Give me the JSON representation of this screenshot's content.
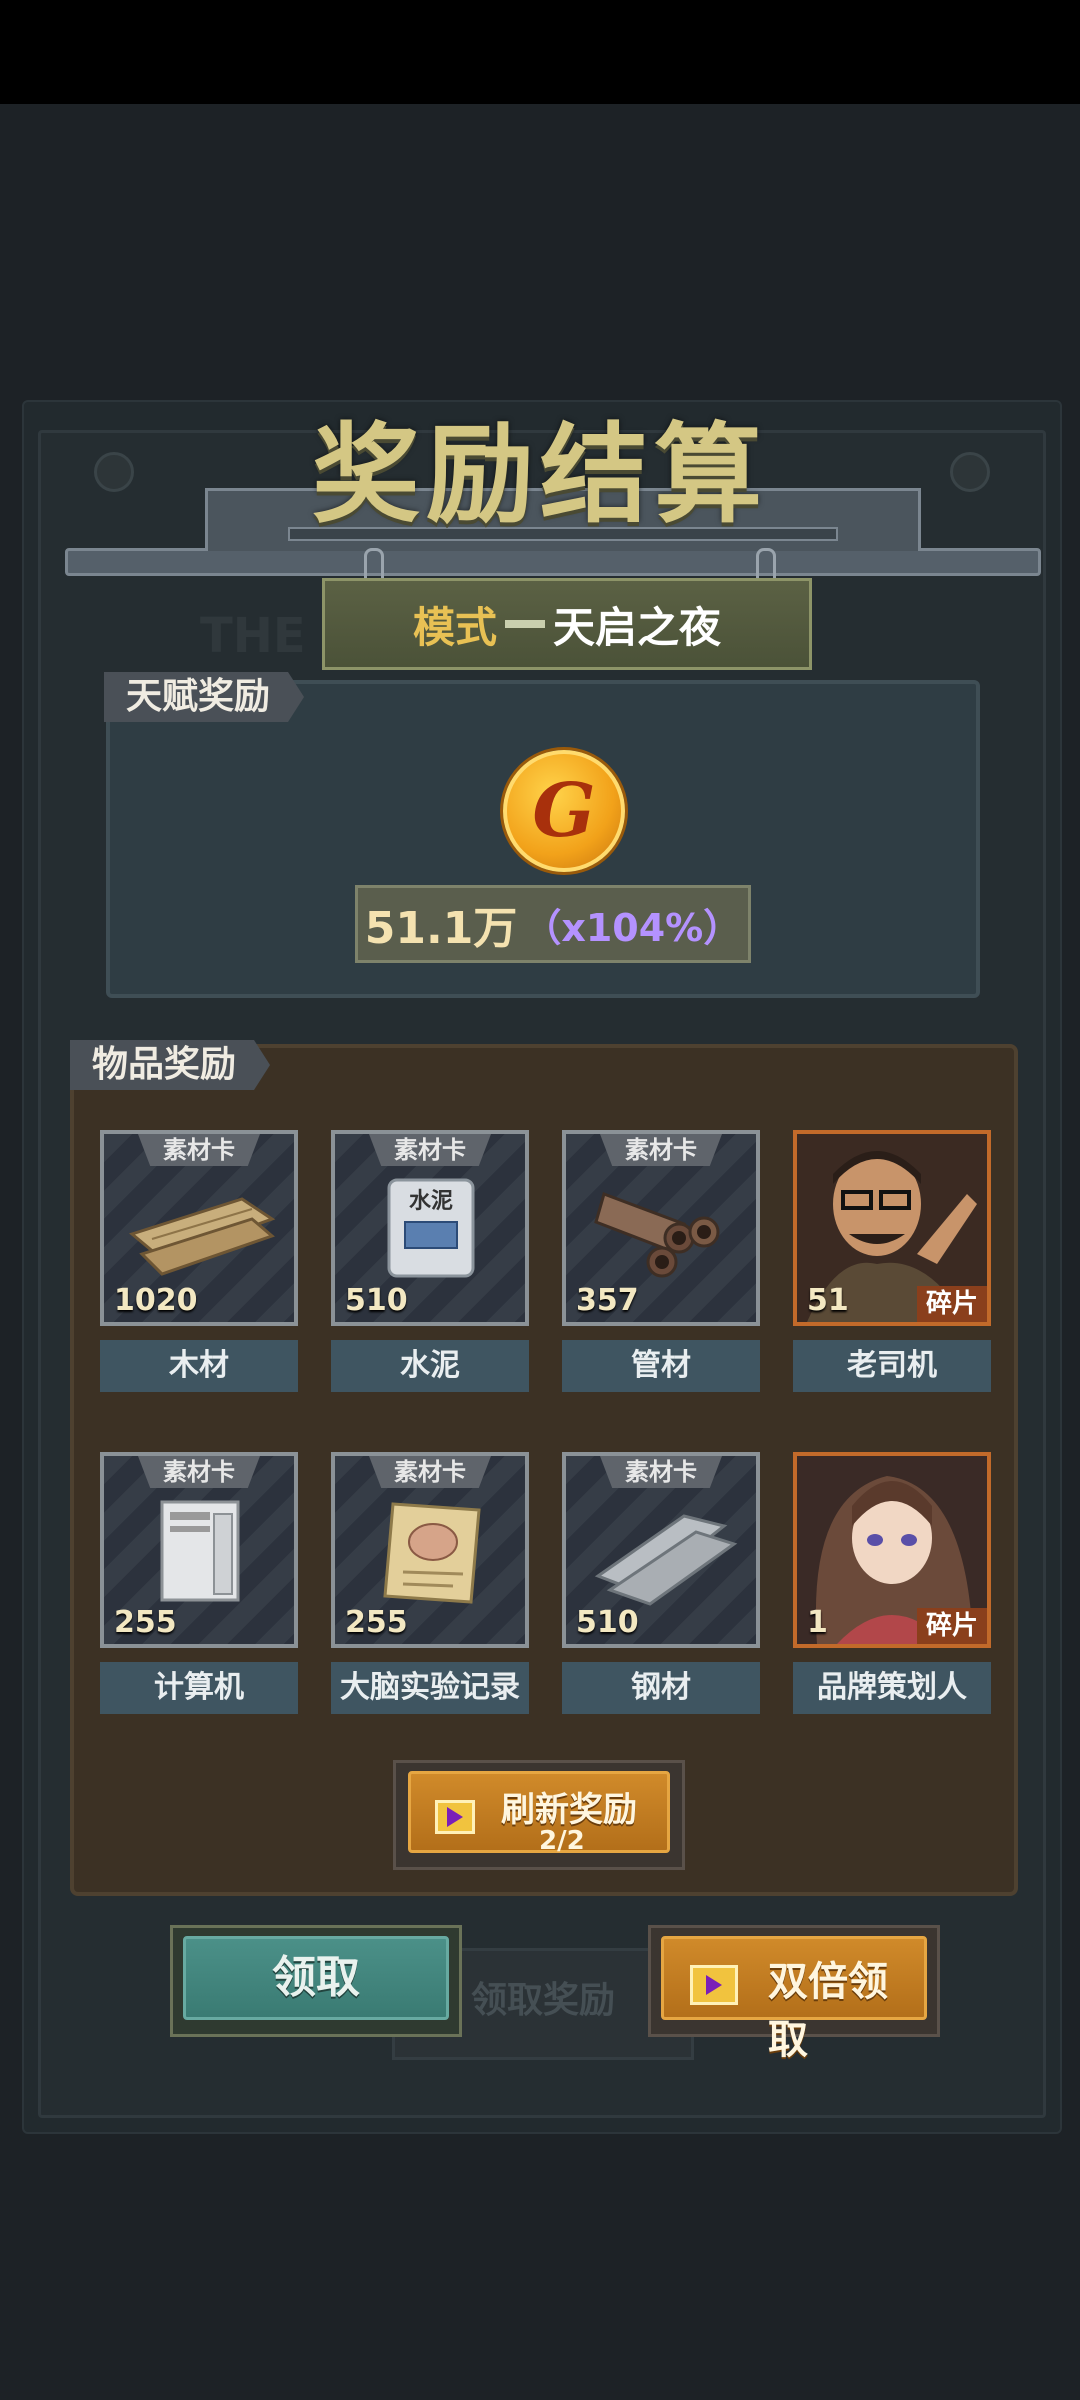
{
  "title": "奖励结算",
  "mode": {
    "label": "模式",
    "name": "天启之夜"
  },
  "talent": {
    "tab_label": "天赋奖励",
    "amount": "51.1万",
    "multiplier": "（x104%）"
  },
  "items": {
    "tab_label": "物品奖励",
    "list": [
      {
        "tag": "素材卡",
        "count": "1020",
        "name": "木材",
        "icon": "wood-planks-icon"
      },
      {
        "tag": "素材卡",
        "count": "510",
        "name": "水泥",
        "icon": "cement-bag-icon",
        "bag_text": "水泥"
      },
      {
        "tag": "素材卡",
        "count": "357",
        "name": "管材",
        "icon": "pipes-icon"
      },
      {
        "tag": "",
        "count": "51",
        "frag": "碎片",
        "name": "老司机",
        "icon": "old-driver-portrait"
      },
      {
        "tag": "素材卡",
        "count": "255",
        "name": "计算机",
        "icon": "computer-icon"
      },
      {
        "tag": "素材卡",
        "count": "255",
        "name": "大脑实验记录",
        "icon": "brain-notes-icon"
      },
      {
        "tag": "素材卡",
        "count": "510",
        "name": "钢材",
        "icon": "steel-plates-icon"
      },
      {
        "tag": "",
        "count": "1",
        "frag": "碎片",
        "name": "品牌策划人",
        "icon": "brand-planner-portrait"
      }
    ]
  },
  "refresh": {
    "label": "刷新奖励",
    "count": "2/2"
  },
  "buttons": {
    "claim": "领取",
    "double_claim": "双倍领取",
    "background_claim": "领取奖励"
  },
  "colors": {
    "accent_gold": "#e8c154",
    "multiplier": "#b492ff",
    "claim": "#3a7b73",
    "video": "#b36f1a"
  }
}
